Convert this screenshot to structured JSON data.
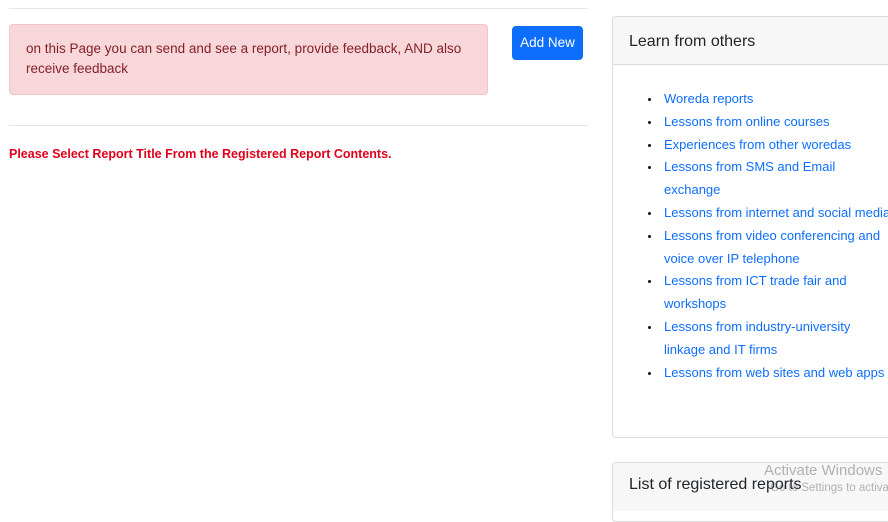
{
  "alert": {
    "message": "on this Page you can send and see a report, provide feedback, AND also receive feedback"
  },
  "toolbar": {
    "add_new_label": "Add New"
  },
  "warning": {
    "text": "Please Select Report Title From the Registered Report Contents."
  },
  "learn_card": {
    "title": "Learn from others",
    "items": [
      {
        "label": "Woreda reports"
      },
      {
        "label": "Lessons from online courses"
      },
      {
        "label": "Experiences from other woredas"
      },
      {
        "label": "Lessons from SMS and Email exchange"
      },
      {
        "label": "Lessons from internet and social media"
      },
      {
        "label": "Lessons from video conferencing and voice over IP telephone"
      },
      {
        "label": "Lessons from ICT trade fair and workshops"
      },
      {
        "label": "Lessons from industry-university linkage and IT firms"
      },
      {
        "label": "Lessons from web sites and web apps"
      }
    ]
  },
  "registered_card": {
    "title": "List of registered reports"
  },
  "watermark": {
    "title": "Activate Windows",
    "subtitle": "Go to Settings to activate Windows."
  },
  "colors": {
    "primary": "#0d6efd",
    "alert_bg": "#f8d7da",
    "alert_text": "#842029",
    "warning_text": "#e0001b"
  }
}
